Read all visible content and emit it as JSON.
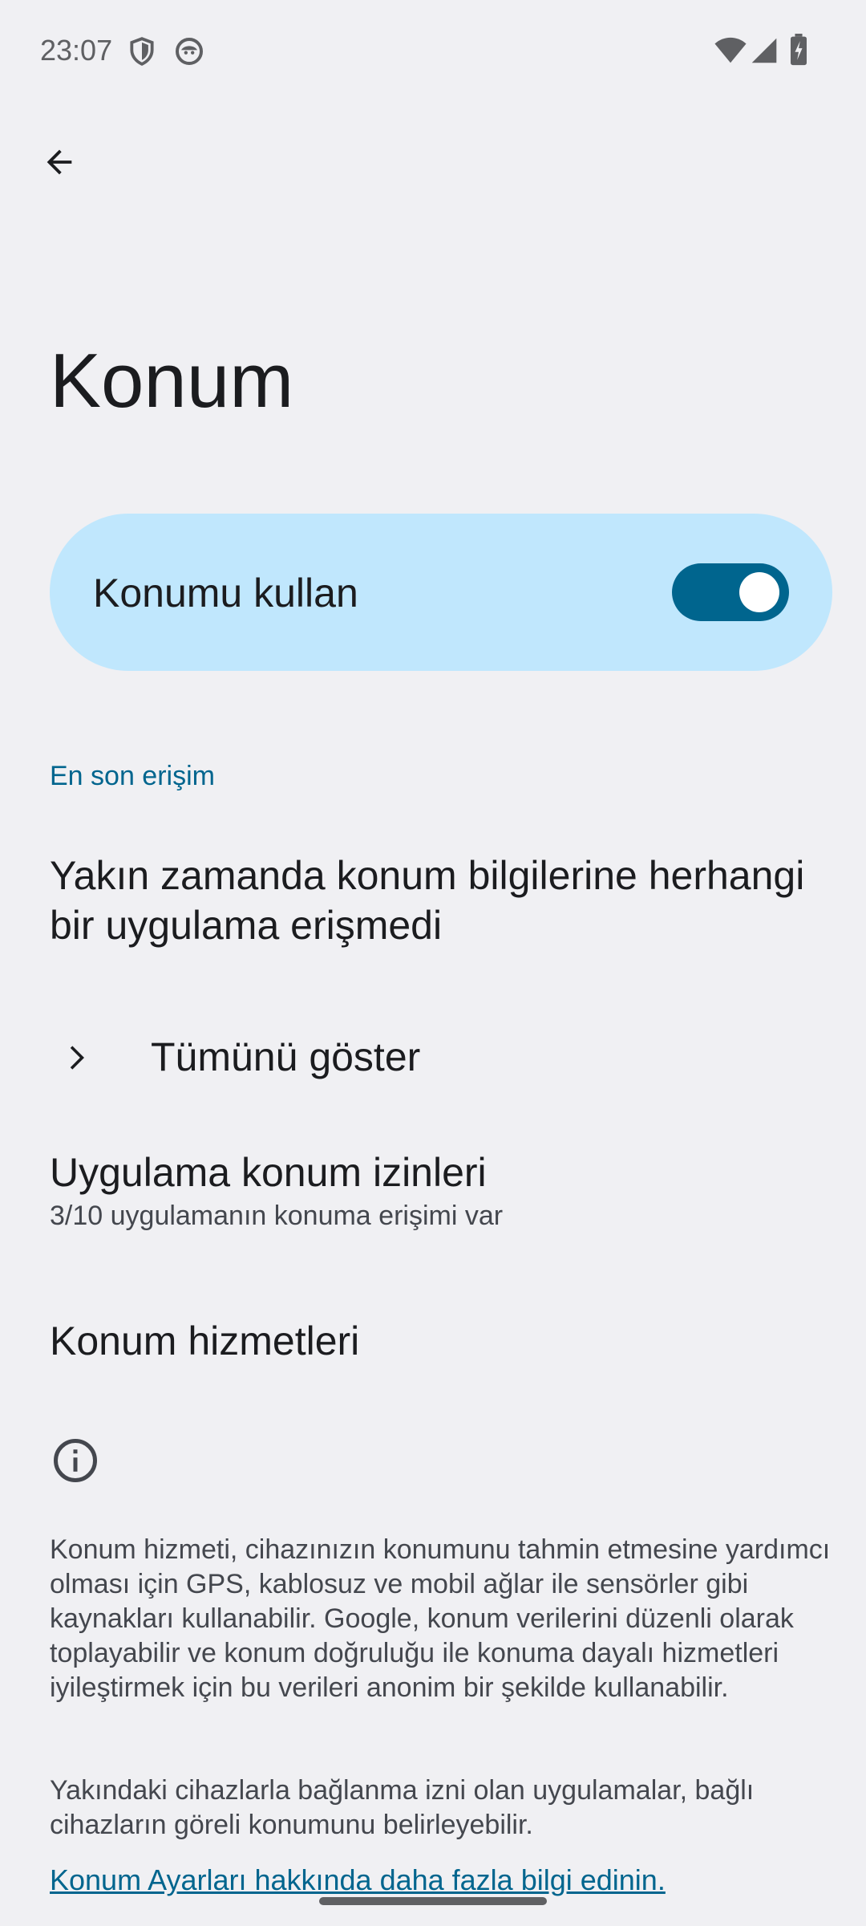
{
  "status_bar": {
    "time": "23:07",
    "icons": [
      "shield-icon",
      "assistant-face-icon",
      "wifi-icon",
      "cell-signal-icon",
      "battery-charging-icon"
    ]
  },
  "header": {
    "back_icon": "arrow-back-icon",
    "title": "Konum"
  },
  "master_switch": {
    "label": "Konumu kullan",
    "checked": true,
    "accent_color": "#00658e",
    "background_color": "#c0e7fd"
  },
  "recent_access": {
    "header": "En son erişim",
    "empty_message": "Yakın zamanda konum bilgilerine herhangi bir uygulama erişmedi",
    "see_all_label": "Tümünü göster"
  },
  "app_permissions": {
    "title": "Uygulama konum izinleri",
    "summary": "3/10 uygulamanın konuma erişimi var"
  },
  "location_services": {
    "title": "Konum hizmetleri"
  },
  "footer": {
    "info_icon": "info-icon",
    "paragraph1": "Konum hizmeti, cihazınızın konumunu tahmin etmesine yardımcı olması için GPS, kablosuz ve mobil ağlar ile sensörler gibi kaynakları kullanabilir. Google, konum verilerini düzenli olarak toplayabilir ve konum doğruluğu ile konuma dayalı hizmetleri iyileştirmek için bu verileri anonim bir şekilde kullanabilir.",
    "paragraph2": "Yakındaki cihazlarla bağlanma izni olan uygulamalar, bağlı cihazların göreli konumunu belirleyebilir.",
    "link": "Konum Ayarları hakkında daha fazla bilgi edinin."
  }
}
